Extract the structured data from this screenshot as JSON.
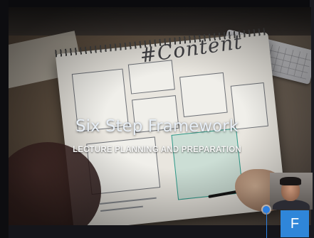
{
  "slide": {
    "title": "Six Step Framework",
    "subtitle": "LECTURE PLANNING AND PREPARATION",
    "image_text": "#Content"
  },
  "participant_tile": {
    "initial": "F",
    "color": "#2f86d9"
  },
  "colors": {
    "title_text": "#e7eef6",
    "subtitle_text": "#f4f4f4",
    "accent_blue": "#2d7fe0"
  }
}
